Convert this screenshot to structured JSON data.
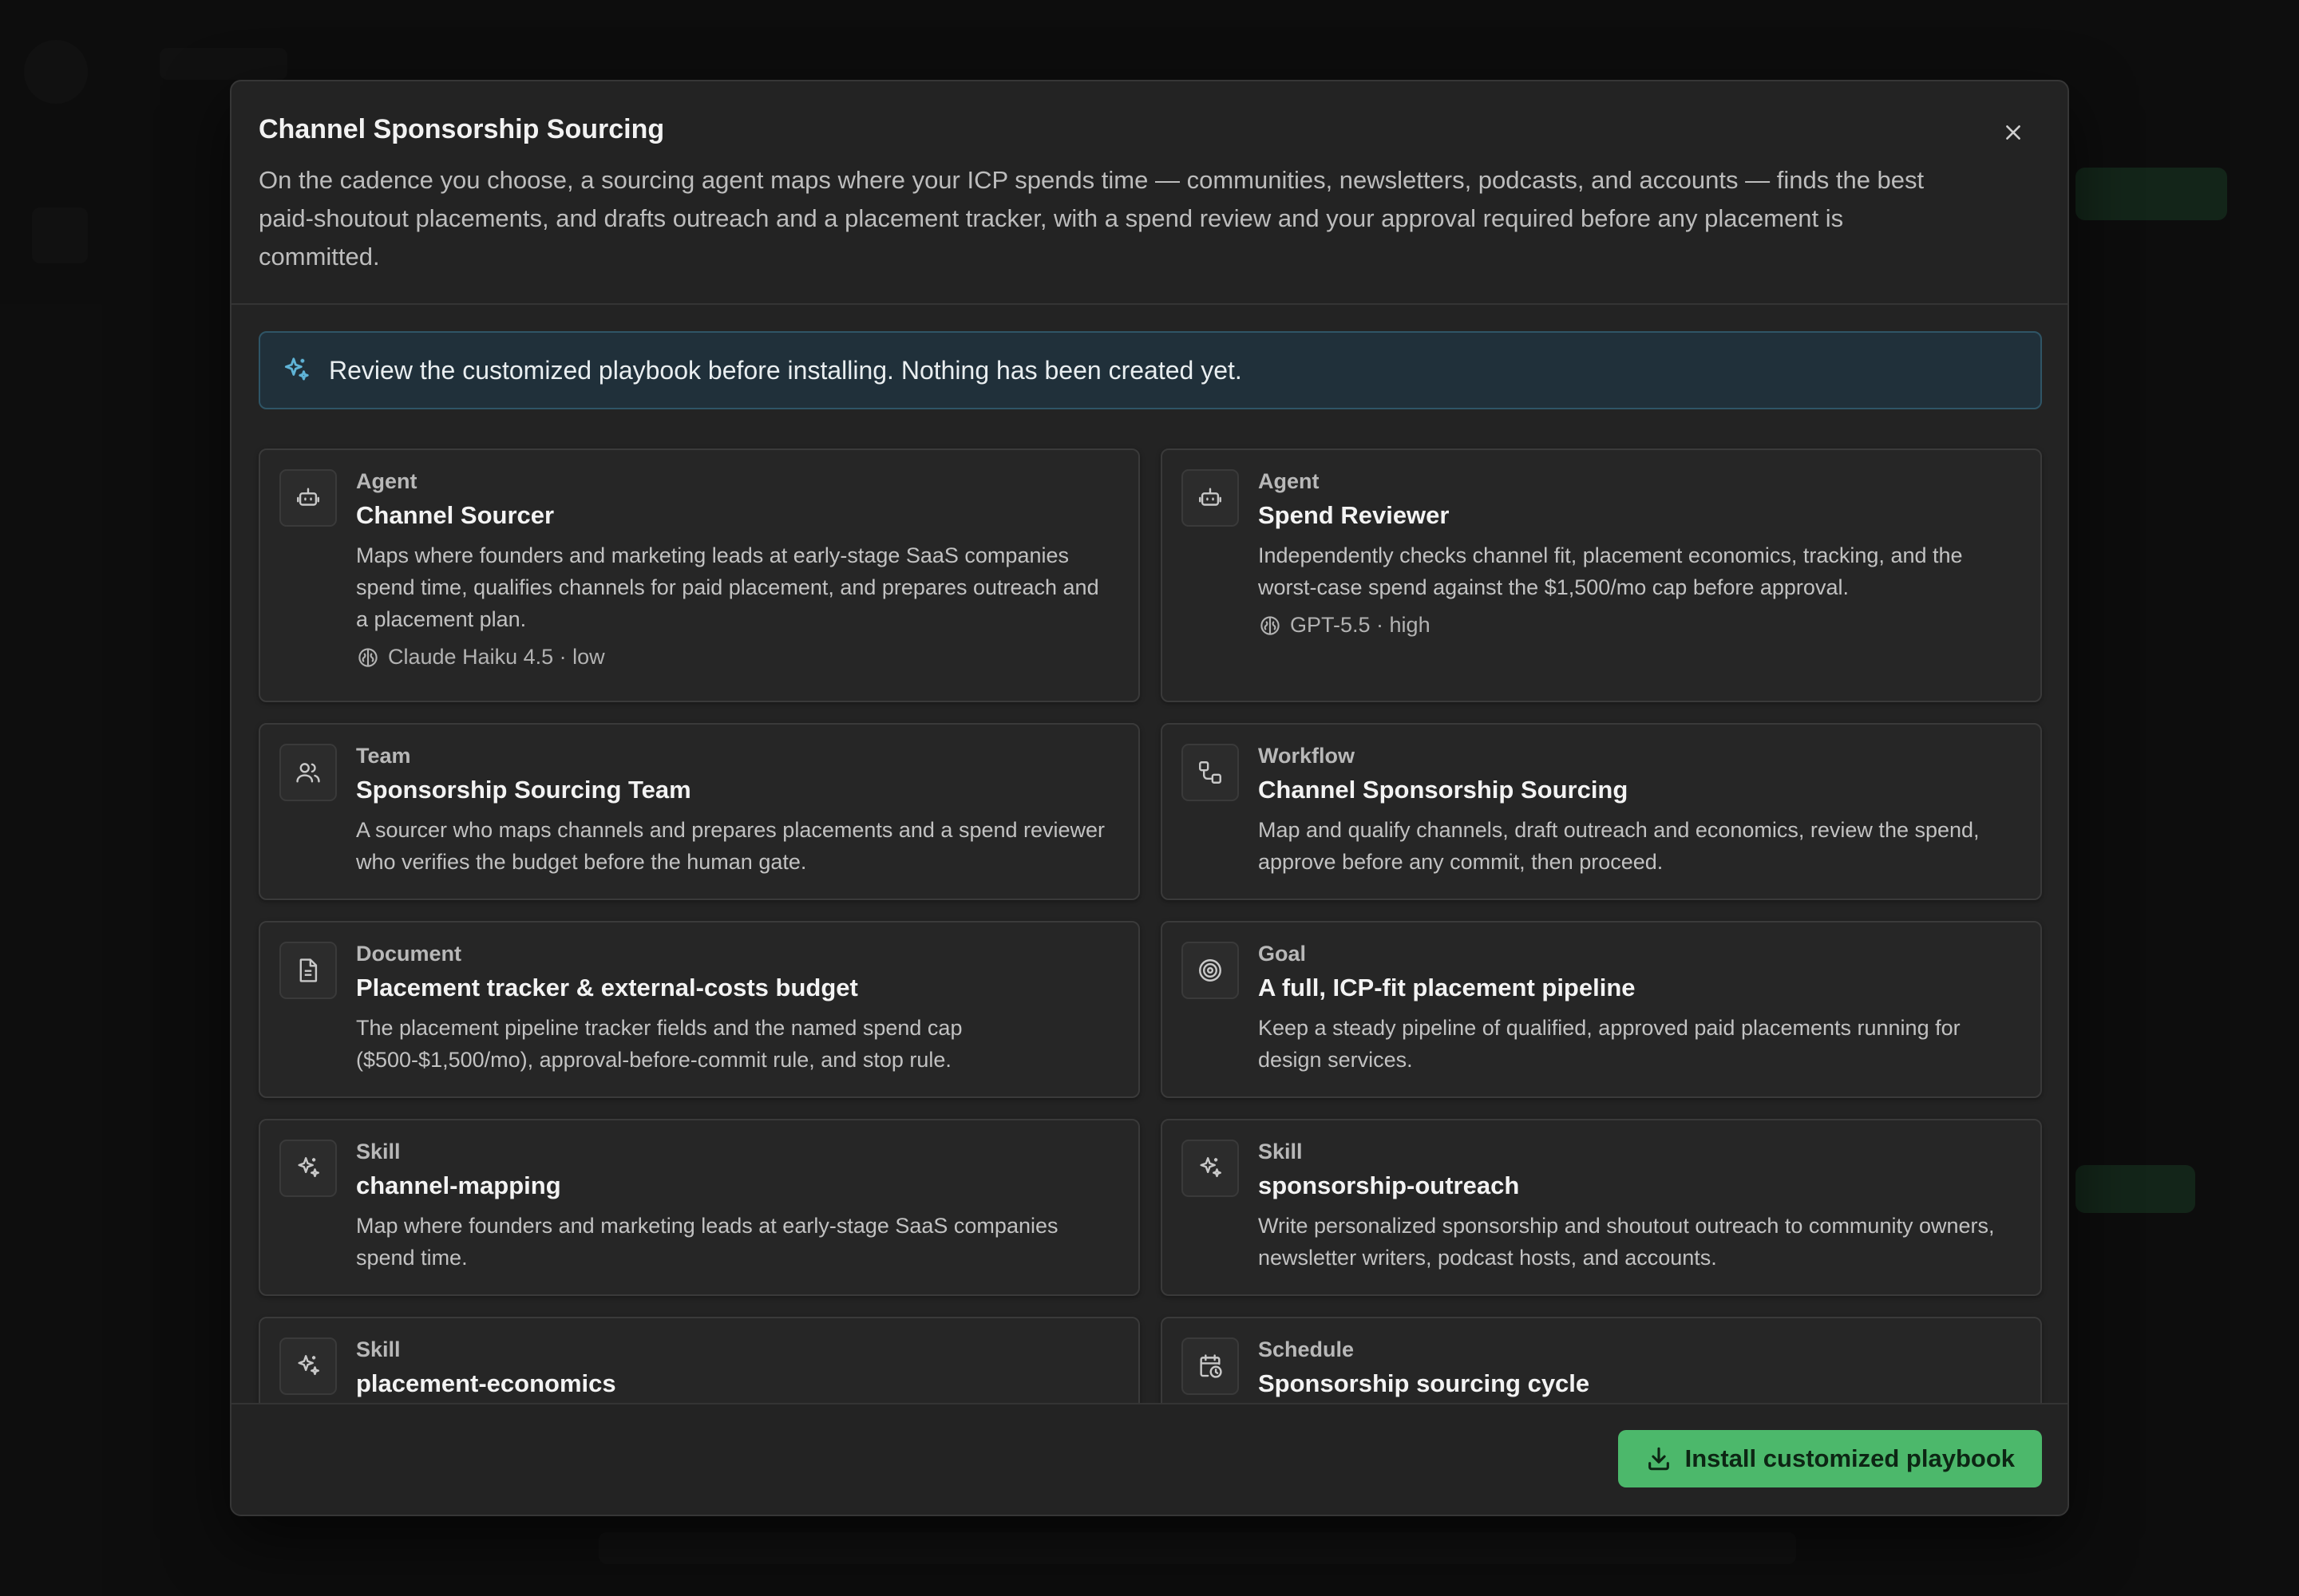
{
  "modal": {
    "title": "Channel Sponsorship Sourcing",
    "description": "On the cadence you choose, a sourcing agent maps where your ICP spends time — communities, newsletters, podcasts, and accounts — finds the best paid-shoutout placements, and drafts outreach and a placement tracker, with a spend review and your approval required before any placement is committed.",
    "close_icon": "close-icon"
  },
  "notice": {
    "text": "Review the customized playbook before installing. Nothing has been created yet.",
    "icon": "sparkle-icon"
  },
  "cards": [
    {
      "kind": "Agent",
      "title": "Channel Sourcer",
      "description": "Maps where founders and marketing leads at early-stage SaaS companies spend time, qualifies channels for paid placement, and prepares outreach and a placement plan.",
      "model": "Claude Haiku 4.5 · low",
      "icon": "bot-icon"
    },
    {
      "kind": "Agent",
      "title": "Spend Reviewer",
      "description": "Independently checks channel fit, placement economics, tracking, and the worst-case spend against the $1,500/mo cap before approval.",
      "model": "GPT-5.5 · high",
      "icon": "bot-icon"
    },
    {
      "kind": "Team",
      "title": "Sponsorship Sourcing Team",
      "description": "A sourcer who maps channels and prepares placements and a spend reviewer who verifies the budget before the human gate.",
      "icon": "users-icon"
    },
    {
      "kind": "Workflow",
      "title": "Channel Sponsorship Sourcing",
      "description": "Map and qualify channels, draft outreach and economics, review the spend, approve before any commit, then proceed.",
      "icon": "workflow-icon"
    },
    {
      "kind": "Document",
      "title": "Placement tracker & external-costs budget",
      "description": "The placement pipeline tracker fields and the named spend cap ($500-$1,500/mo), approval-before-commit rule, and stop rule.",
      "icon": "document-icon"
    },
    {
      "kind": "Goal",
      "title": "A full, ICP-fit placement pipeline",
      "description": "Keep a steady pipeline of qualified, approved paid placements running for design services.",
      "icon": "target-icon"
    },
    {
      "kind": "Skill",
      "title": "channel-mapping",
      "description": "Map where founders and marketing leads at early-stage SaaS companies spend time.",
      "icon": "sparkle-icon"
    },
    {
      "kind": "Skill",
      "title": "sponsorship-outreach",
      "description": "Write personalized sponsorship and shoutout outreach to community owners, newsletter writers, podcast hosts, and accounts.",
      "icon": "sparkle-icon"
    },
    {
      "kind": "Skill",
      "title": "placement-economics",
      "description": "",
      "icon": "sparkle-icon"
    },
    {
      "kind": "Schedule",
      "title": "Sponsorship sourcing cycle",
      "description": "",
      "icon": "calendar-clock-icon"
    }
  ],
  "footer": {
    "install_label": "Install customized playbook",
    "install_icon": "download-icon"
  },
  "colors": {
    "accent_green": "#4cb86b",
    "notice_bg": "#20303a",
    "modal_bg": "#232323"
  }
}
